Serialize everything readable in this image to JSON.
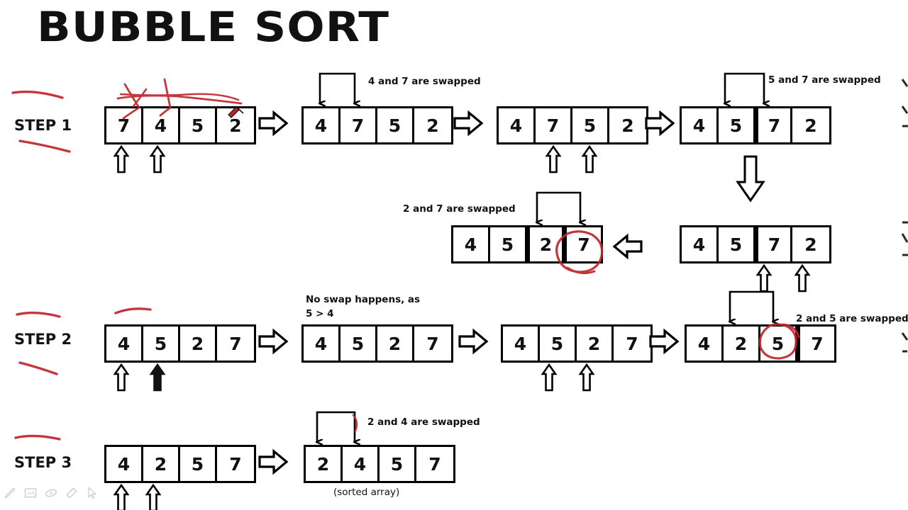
{
  "title": "BUBBLE SORT",
  "steps": [
    {
      "label": "STEP 1"
    },
    {
      "label": "STEP 2"
    },
    {
      "label": "STEP 3"
    }
  ],
  "captions": {
    "swap_4_7": "4 and 7 are swapped",
    "swap_5_7": "5 and 7 are swapped",
    "swap_2_7": "2 and 7 are swapped",
    "no_swap": "No swap happens, as",
    "no_swap_cond": "5 > 4",
    "swap_2_5": "2 and 5 are swapped",
    "swap_2_4": "2 and 4 are swapped",
    "sorted": "(sorted array)"
  },
  "arrays": {
    "s1a": {
      "values": [
        "7",
        "4",
        "5",
        "2"
      ],
      "compare": [
        0,
        1
      ]
    },
    "s1b": {
      "values": [
        "4",
        "7",
        "5",
        "2"
      ],
      "compare": [
        0,
        1
      ]
    },
    "s1c": {
      "values": [
        "4",
        "7",
        "5",
        "2"
      ],
      "compare": [
        1,
        2
      ]
    },
    "s1d": {
      "values": [
        "4",
        "5",
        "7",
        "2"
      ],
      "compare": [
        1,
        2
      ]
    },
    "s1e": {
      "values": [
        "4",
        "5",
        "7",
        "2"
      ],
      "compare": [
        2,
        3
      ]
    },
    "s1f": {
      "values": [
        "4",
        "5",
        "2",
        "7"
      ],
      "compare": [
        2,
        3
      ]
    },
    "s2a": {
      "values": [
        "4",
        "5",
        "2",
        "7"
      ],
      "compare": [
        0,
        1
      ]
    },
    "s2b": {
      "values": [
        "4",
        "5",
        "2",
        "7"
      ],
      "compare": [
        0,
        1
      ]
    },
    "s2c": {
      "values": [
        "4",
        "5",
        "2",
        "7"
      ],
      "compare": [
        1,
        2
      ]
    },
    "s2d": {
      "values": [
        "4",
        "2",
        "5",
        "7"
      ],
      "compare": [
        1,
        2
      ]
    },
    "s3a": {
      "values": [
        "4",
        "2",
        "5",
        "7"
      ],
      "compare": [
        0,
        1
      ]
    },
    "s3b": {
      "values": [
        "2",
        "4",
        "5",
        "7"
      ],
      "compare": [
        0,
        1
      ]
    }
  },
  "annotations": {
    "ink_color": "#c0252b",
    "circled_values": [
      "7",
      "5"
    ],
    "tool_icons": [
      "pen-icon",
      "screenshot-icon",
      "highlighter-icon",
      "eraser-icon",
      "cursor-icon"
    ]
  },
  "colors": {
    "background": "#ffffff",
    "stroke": "#000000",
    "text": "#111111",
    "ink": "#c0252b"
  }
}
